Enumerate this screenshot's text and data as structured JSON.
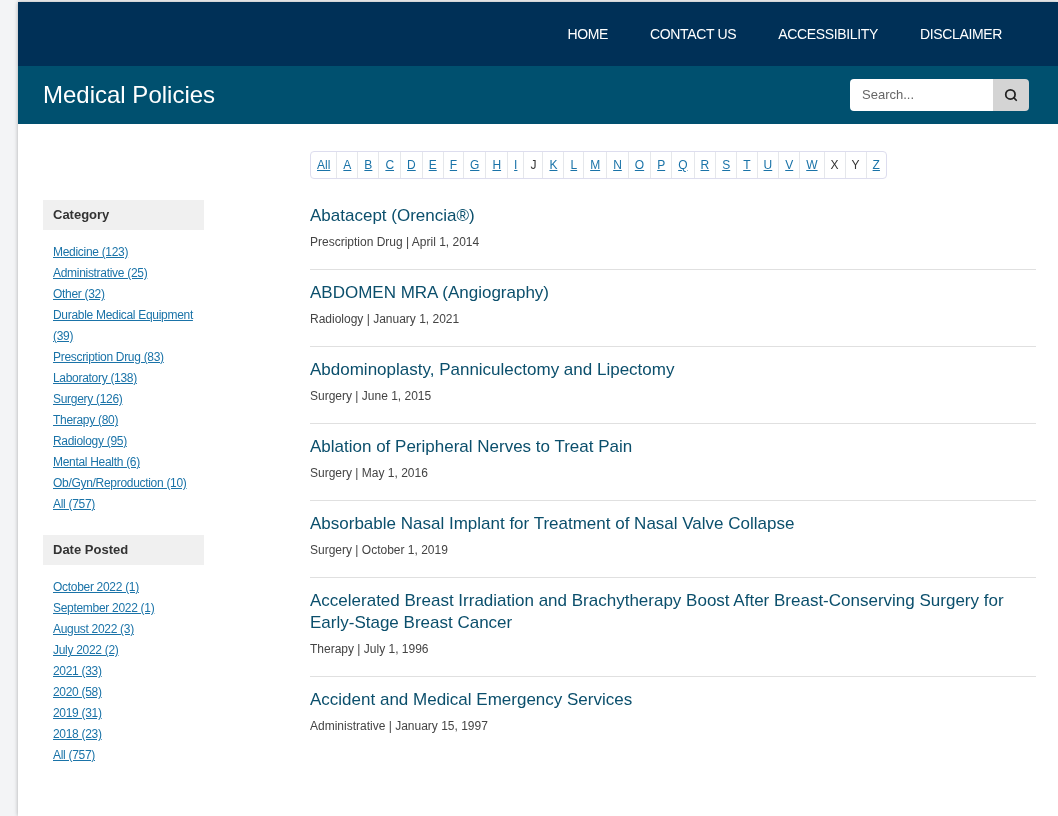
{
  "nav": [
    "HOME",
    "CONTACT US",
    "ACCESSIBILITY",
    "DISCLAIMER"
  ],
  "header": {
    "title": "Medical Policies",
    "search": {
      "placeholder": "Search..."
    }
  },
  "letters": [
    {
      "label": "All",
      "disabled": false
    },
    {
      "label": "A",
      "disabled": false
    },
    {
      "label": "B",
      "disabled": false
    },
    {
      "label": "C",
      "disabled": false
    },
    {
      "label": "D",
      "disabled": false
    },
    {
      "label": "E",
      "disabled": false
    },
    {
      "label": "F",
      "disabled": false
    },
    {
      "label": "G",
      "disabled": false
    },
    {
      "label": "H",
      "disabled": false
    },
    {
      "label": "I",
      "disabled": false
    },
    {
      "label": "J",
      "disabled": true
    },
    {
      "label": "K",
      "disabled": false
    },
    {
      "label": "L",
      "disabled": false
    },
    {
      "label": "M",
      "disabled": false
    },
    {
      "label": "N",
      "disabled": false
    },
    {
      "label": "O",
      "disabled": false
    },
    {
      "label": "P",
      "disabled": false
    },
    {
      "label": "Q",
      "disabled": false
    },
    {
      "label": "R",
      "disabled": false
    },
    {
      "label": "S",
      "disabled": false
    },
    {
      "label": "T",
      "disabled": false
    },
    {
      "label": "U",
      "disabled": false
    },
    {
      "label": "V",
      "disabled": false
    },
    {
      "label": "W",
      "disabled": false
    },
    {
      "label": "X",
      "disabled": true
    },
    {
      "label": "Y",
      "disabled": true
    },
    {
      "label": "Z",
      "disabled": false
    }
  ],
  "sidebar": [
    {
      "heading": "Category",
      "links": [
        "Medicine (123)",
        "Administrative (25)",
        "Other (32)",
        "Durable Medical Equipment (39)",
        "Prescription Drug (83)",
        "Laboratory (138)",
        "Surgery (126)",
        "Therapy (80)",
        "Radiology (95)",
        "Mental Health (6)",
        "Ob/Gyn/Reproduction (10)",
        "All (757)"
      ]
    },
    {
      "heading": "Date Posted",
      "links": [
        "October 2022 (1)",
        "September 2022 (1)",
        "August 2022 (3)",
        "July 2022 (2)",
        "2021 (33)",
        "2020 (58)",
        "2019 (31)",
        "2018 (23)",
        "All (757)"
      ]
    }
  ],
  "policies": [
    {
      "title": "Abatacept (Orencia®)",
      "meta": "Prescription Drug | April 1, 2014"
    },
    {
      "title": "ABDOMEN MRA (Angiography)",
      "meta": "Radiology | January 1, 2021"
    },
    {
      "title": "Abdominoplasty, Panniculectomy and Lipectomy",
      "meta": "Surgery | June 1, 2015"
    },
    {
      "title": "Ablation of Peripheral Nerves to Treat Pain",
      "meta": "Surgery | May 1, 2016"
    },
    {
      "title": "Absorbable Nasal Implant for Treatment of Nasal Valve Collapse",
      "meta": "Surgery | October 1, 2019"
    },
    {
      "title": "Accelerated Breast Irradiation and Brachytherapy Boost After Breast-Conserving Surgery for Early-Stage Breast Cancer",
      "meta": "Therapy | July 1, 1996"
    },
    {
      "title": "Accident and Medical Emergency Services",
      "meta": "Administrative | January 15, 1997"
    }
  ]
}
